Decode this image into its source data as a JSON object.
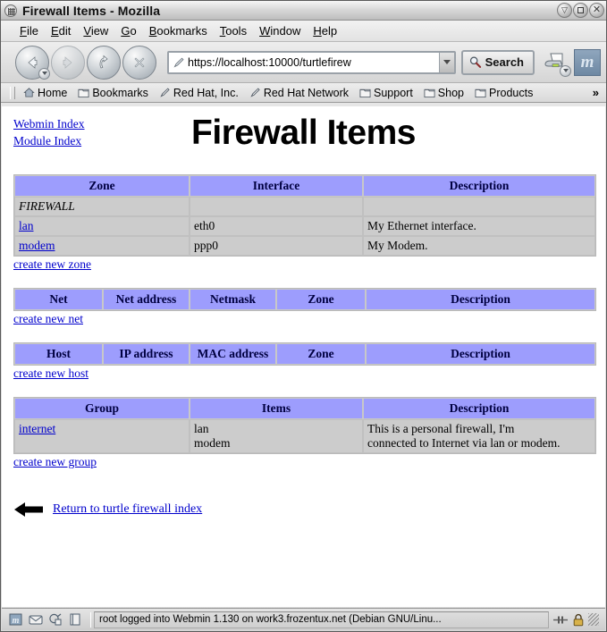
{
  "window": {
    "title": "Firewall Items - Mozilla",
    "icon": "mozilla-window-icon",
    "minimize_label": "▽",
    "maximize_label": "",
    "close_label": "✕"
  },
  "menubar": {
    "items": [
      {
        "accesskey": "F",
        "rest": "ile"
      },
      {
        "accesskey": "E",
        "rest": "dit"
      },
      {
        "accesskey": "V",
        "rest": "iew"
      },
      {
        "accesskey": "G",
        "rest": "o"
      },
      {
        "accesskey": "B",
        "rest": "ookmarks"
      },
      {
        "accesskey": "T",
        "rest": "ools"
      },
      {
        "accesskey": "W",
        "rest": "indow"
      },
      {
        "accesskey": "H",
        "rest": "elp"
      }
    ]
  },
  "toolbar": {
    "back_label": "Back",
    "forward_label": "Forward",
    "reload_label": "Reload",
    "stop_label": "Stop",
    "print_label": "Print",
    "mozilla_logo_label": "m",
    "search_label": "Search"
  },
  "urlbar": {
    "value": "https://localhost:10000/turtlefirew",
    "placeholder": "Enter address"
  },
  "bookmarks_toolbar": {
    "items": [
      {
        "label": "Home",
        "icon": "home-icon"
      },
      {
        "label": "Bookmarks",
        "icon": "folder-icon"
      },
      {
        "label": "Red Hat, Inc.",
        "icon": "bookmark-icon"
      },
      {
        "label": "Red Hat Network",
        "icon": "bookmark-icon"
      },
      {
        "label": "Support",
        "icon": "folder-icon"
      },
      {
        "label": "Shop",
        "icon": "folder-icon"
      },
      {
        "label": "Products",
        "icon": "folder-icon"
      }
    ],
    "overflow_label": "»"
  },
  "page": {
    "index_links": [
      {
        "label": "Webmin Index"
      },
      {
        "label": "Module Index"
      }
    ],
    "title": "Firewall Items",
    "zones": {
      "headers": [
        "Zone",
        "Interface",
        "Description"
      ],
      "rows": [
        {
          "zone": "FIREWALL",
          "zone_is_link": false,
          "interface": "",
          "description": ""
        },
        {
          "zone": "lan",
          "zone_is_link": true,
          "interface": "eth0",
          "description": "My Ethernet interface."
        },
        {
          "zone": "modem",
          "zone_is_link": true,
          "interface": "ppp0",
          "description": "My Modem."
        }
      ],
      "create_link": "create new zone"
    },
    "nets": {
      "headers": [
        "Net",
        "Net address",
        "Netmask",
        "Zone",
        "Description"
      ],
      "rows": [],
      "create_link": "create new net"
    },
    "hosts": {
      "headers": [
        "Host",
        "IP address",
        "MAC address",
        "Zone",
        "Description"
      ],
      "rows": [],
      "create_link": "create new host"
    },
    "groups": {
      "headers": [
        "Group",
        "Items",
        "Description"
      ],
      "rows": [
        {
          "group": "internet",
          "items_line1": "lan",
          "items_line2": "modem",
          "description_line1": "This is a personal firewall, I'm",
          "description_line2": "connected to Internet via lan or modem."
        }
      ],
      "create_link": "create new group"
    },
    "return_link": "Return to turtle firewall index",
    "return_icon": "left-arrow-icon"
  },
  "statusbar": {
    "text": "root logged into Webmin 1.130 on work3.frozentux.net (Debian GNU/Linu...",
    "icons": [
      "browser-icon",
      "mail-icon",
      "composer-icon",
      "addressbook-icon"
    ],
    "security_icon": "padlock-icon",
    "progress_icon": "transfer-icon"
  },
  "colors": {
    "table_header": "#9d9dfd",
    "table_cell": "#cccccc",
    "link": "#0000cc"
  }
}
